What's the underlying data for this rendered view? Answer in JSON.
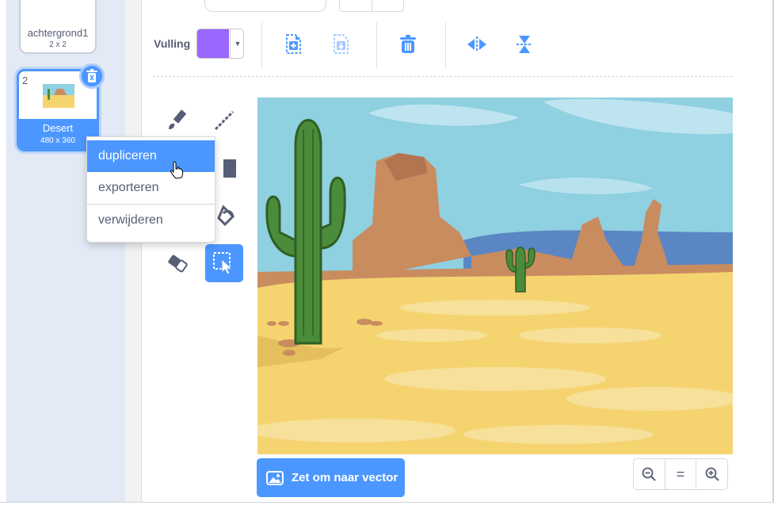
{
  "costumes": [
    {
      "name": "achtergrond1",
      "size": "2 x 2"
    },
    {
      "number": "2",
      "name": "Desert",
      "size": "480 x 360"
    }
  ],
  "context_menu": {
    "items": [
      {
        "label": "dupliceren",
        "active": true
      },
      {
        "label": "exporteren"
      },
      {
        "label": "verwijderen"
      }
    ]
  },
  "toolbar": {
    "fill_label": "Vulling",
    "fill_color": "#9966ff",
    "icons": [
      "new-costume-icon",
      "import-icon",
      "delete-icon",
      "flip-horizontal-icon",
      "flip-vertical-icon"
    ]
  },
  "tools": [
    "brush-icon",
    "line-icon",
    "rectangle-icon",
    "fill-bucket-icon",
    "eraser-icon",
    "select-icon"
  ],
  "footer": {
    "convert_label": "Zet om naar vector",
    "zoom_reset_label": "="
  },
  "colors": {
    "accent": "#4c97ff",
    "text": "#575e75",
    "sky": "#8fd0e1",
    "sand": "#f5d470",
    "rock": "#c98c5f",
    "cactus": "#4a8c3a"
  }
}
